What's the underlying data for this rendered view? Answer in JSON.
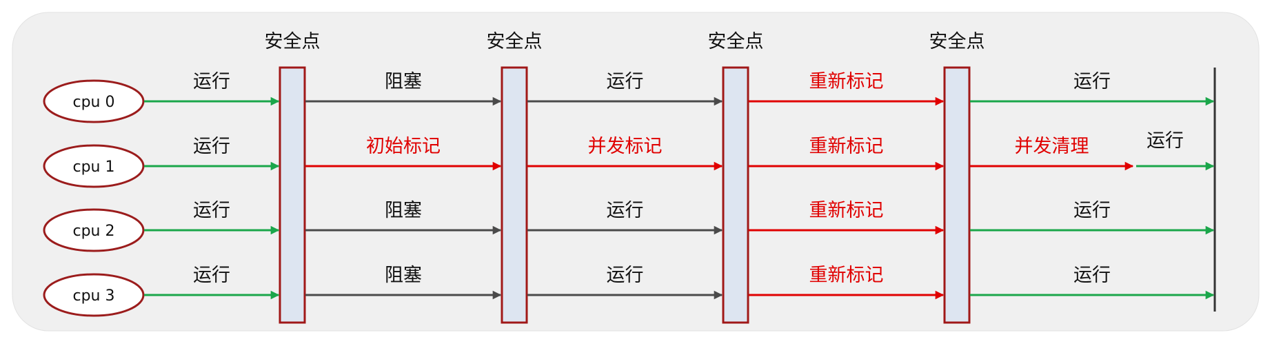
{
  "safepoint_label": "安全点",
  "cpus": [
    {
      "label": "cpu 0",
      "segments": [
        "运行",
        "阻塞",
        "运行",
        "重新标记",
        "运行"
      ],
      "tail": null
    },
    {
      "label": "cpu 1",
      "segments": [
        "运行",
        "初始标记",
        "并发标记",
        "重新标记",
        "并发清理"
      ],
      "tail": "运行"
    },
    {
      "label": "cpu 2",
      "segments": [
        "运行",
        "阻塞",
        "运行",
        "重新标记",
        "运行"
      ],
      "tail": null
    },
    {
      "label": "cpu 3",
      "segments": [
        "运行",
        "阻塞",
        "运行",
        "重新标记",
        "运行"
      ],
      "tail": null
    }
  ],
  "colors": {
    "panel": "#f0f0f0",
    "cpu_border": "#9b1c1c",
    "run": "#1aa64a",
    "block": "#4a4a4a",
    "gc": "#e00000",
    "bar_fill": "#dde5f1",
    "bar_border": "#a01818",
    "end_line": "#333333"
  }
}
